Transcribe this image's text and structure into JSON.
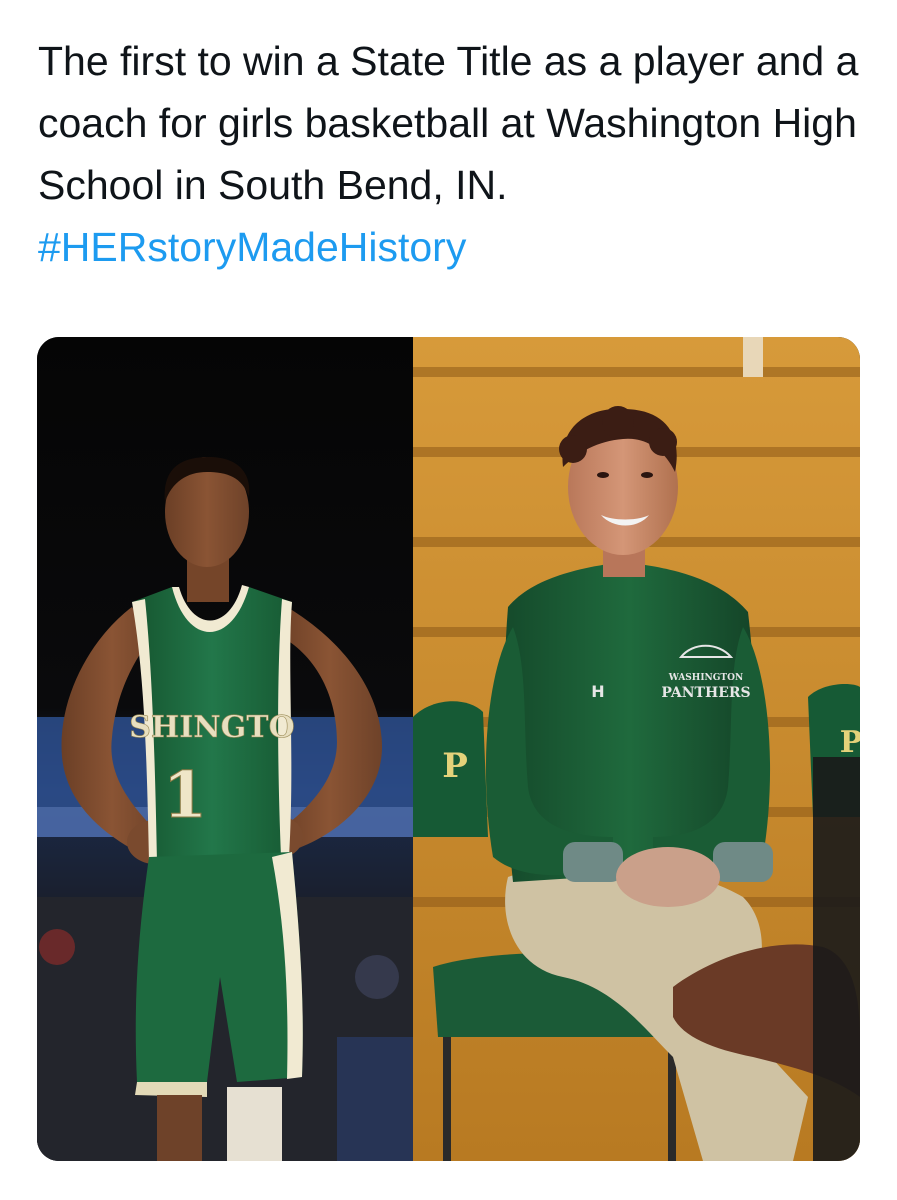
{
  "post": {
    "text": "The first to win a State Title as a player and a coach for girls basketball at Washington High School in South Bend, IN.",
    "hashtag": "#HERstoryMadeHistory"
  },
  "photos": {
    "left": {
      "jersey_text": "SHINGTO",
      "jersey_number": "1"
    },
    "right": {
      "logo_line1": "WASHINGTON",
      "logo_line2": "PANTHERS",
      "chair_letters_left": "P",
      "chair_letters_right": "P"
    }
  },
  "colors": {
    "text": "#0f1419",
    "hashtag": "#1d9bf0",
    "jersey_green": "#1f6b3c",
    "jacket_green": "#1c5a36",
    "bleacher_wood": "#c98a2a"
  }
}
